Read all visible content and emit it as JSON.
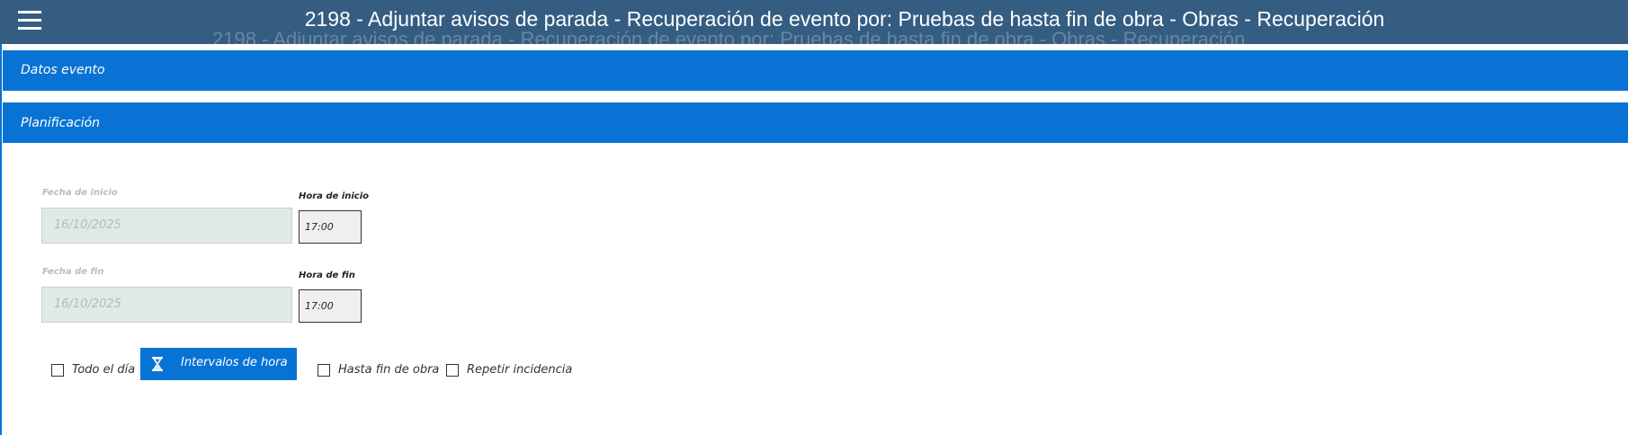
{
  "header": {
    "title": "2198 - Adjuntar avisos de parada - Recuperación de evento por: Pruebas de hasta fin de obra - Obras - Recuperación",
    "menu_icon": "hamburger-menu-icon"
  },
  "sections": {
    "datos_evento": "Datos evento",
    "planificacion": "Planificación"
  },
  "planificacion": {
    "fecha_inicio": {
      "label": "Fecha de inicio",
      "value": "16/10/2025"
    },
    "hora_inicio": {
      "label": "Hora de inicio",
      "value": "17:00"
    },
    "fecha_fin": {
      "label": "Fecha de fin",
      "value": "16/10/2025"
    },
    "hora_fin": {
      "label": "Hora de fin",
      "value": "17:00"
    },
    "todo_el_dia": {
      "label": "Todo el día",
      "checked": false
    },
    "intervalos_button": {
      "label": "Intervalos de hora",
      "icon": "hourglass-icon"
    },
    "hasta_fin_obra": {
      "label": "Hasta fin de obra",
      "checked": false
    },
    "repetir_incidencia": {
      "label": "Repetir incidencia",
      "checked": false
    }
  },
  "colors": {
    "header_bg": "#355d82",
    "accent": "#0873d4",
    "disabled_input_bg": "#e1e9e8",
    "time_input_bg": "#efefef"
  }
}
